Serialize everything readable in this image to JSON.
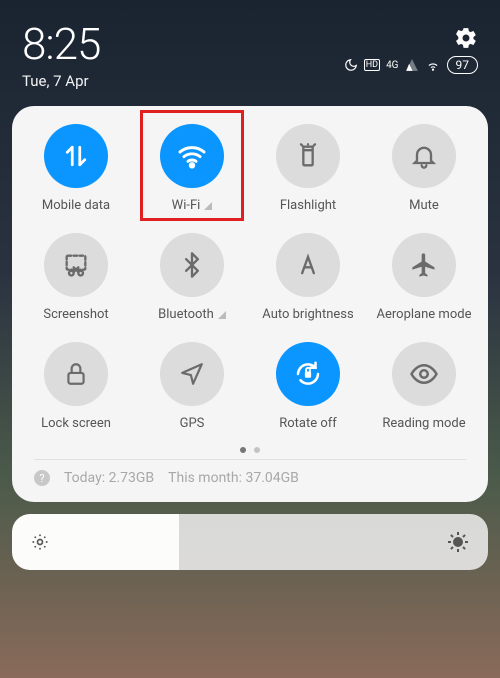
{
  "statusbar": {
    "time": "8:25",
    "date": "Tue, 7 Apr",
    "battery": "97",
    "network_label": "4G"
  },
  "tiles": [
    {
      "id": "mobile-data",
      "label": "Mobile data",
      "active": true
    },
    {
      "id": "wifi",
      "label": "Wi-Fi",
      "active": true,
      "highlighted": true,
      "has_signal": true
    },
    {
      "id": "flashlight",
      "label": "Flashlight",
      "active": false
    },
    {
      "id": "mute",
      "label": "Mute",
      "active": false
    },
    {
      "id": "screenshot",
      "label": "Screenshot",
      "active": false
    },
    {
      "id": "bluetooth",
      "label": "Bluetooth",
      "active": false,
      "has_signal": true
    },
    {
      "id": "auto-brightness",
      "label": "Auto brightness",
      "active": false
    },
    {
      "id": "aeroplane",
      "label": "Aeroplane mode",
      "active": false
    },
    {
      "id": "lock-screen",
      "label": "Lock screen",
      "active": false
    },
    {
      "id": "gps",
      "label": "GPS",
      "active": false
    },
    {
      "id": "rotate-off",
      "label": "Rotate off",
      "active": true
    },
    {
      "id": "reading-mode",
      "label": "Reading mode",
      "active": false
    }
  ],
  "usage": {
    "today_label": "Today:",
    "today_value": "2.73GB",
    "month_label": "This month:",
    "month_value": "37.04GB"
  },
  "colors": {
    "accent": "#0b95ff",
    "highlight": "#e02020"
  }
}
